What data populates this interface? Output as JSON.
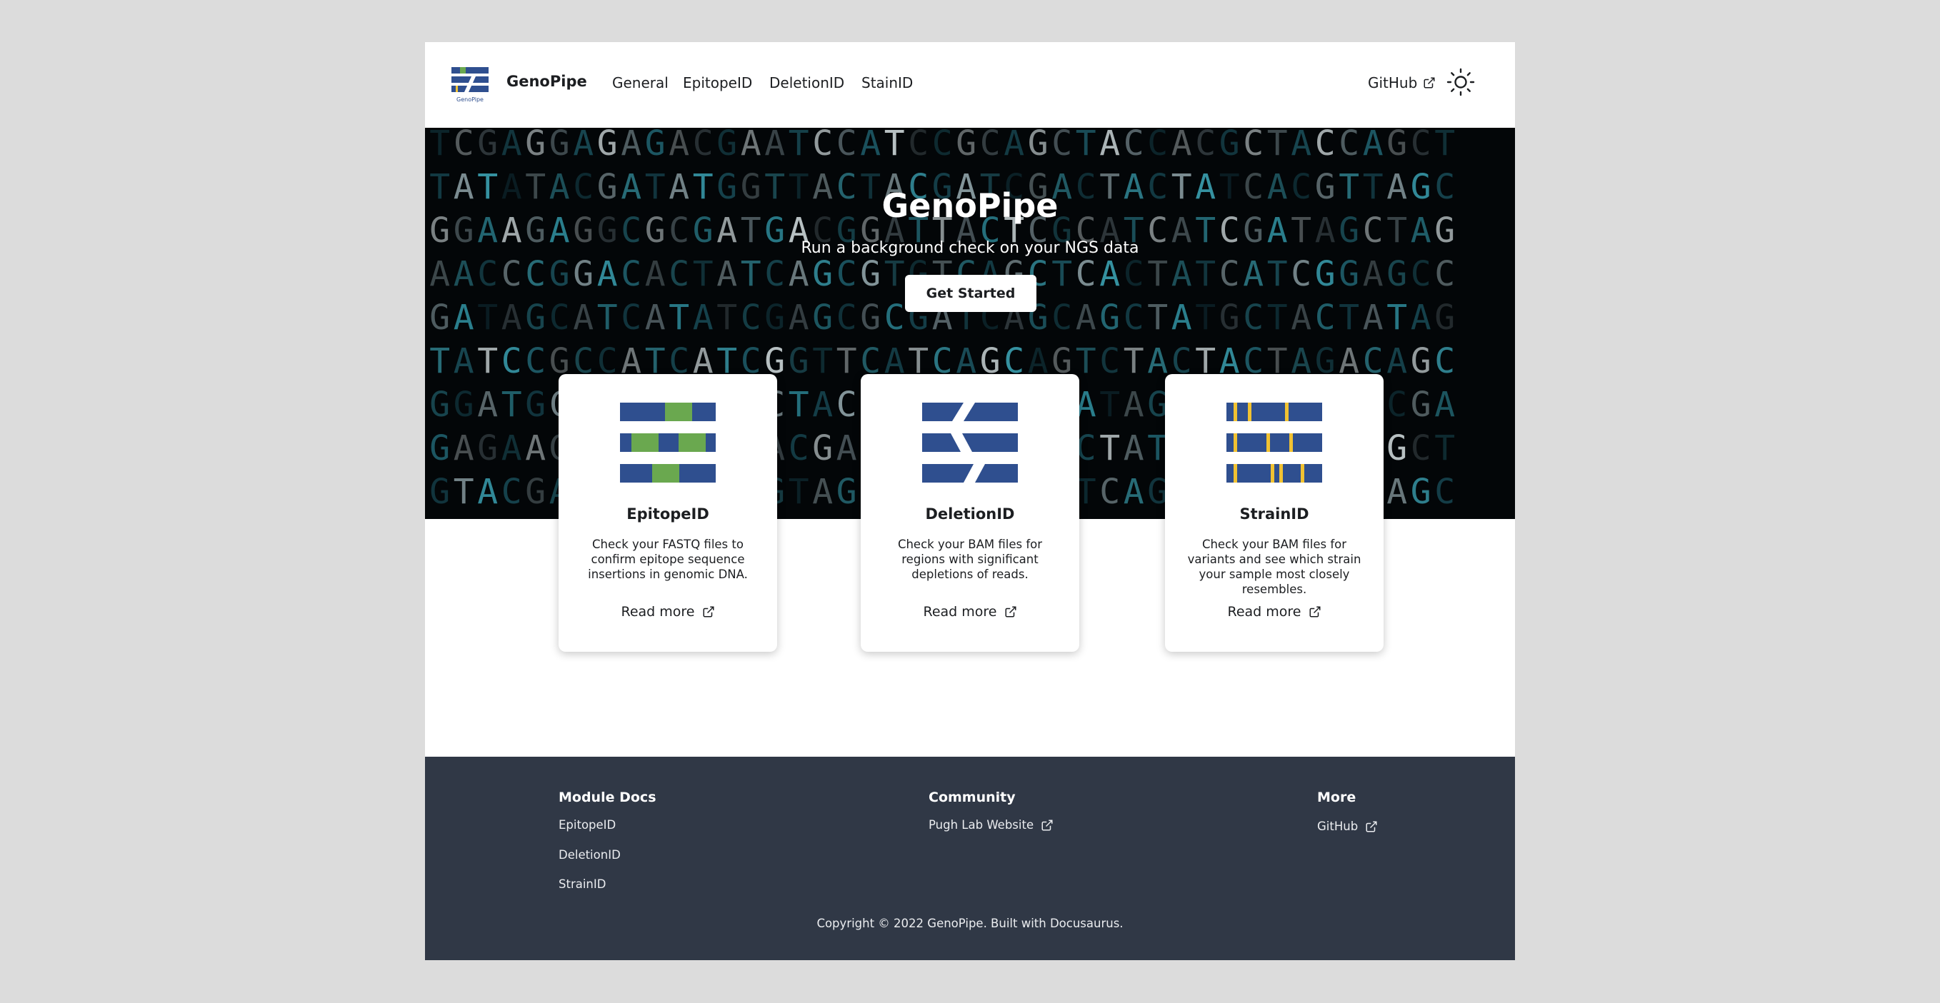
{
  "navbar": {
    "brand": "GenoPipe",
    "logo_caption": "GenoPipe",
    "links": [
      "General",
      "EpitopeID",
      "DeletionID",
      "StainID"
    ],
    "github": "GitHub",
    "theme_icon": "sun-icon"
  },
  "hero": {
    "title": "GenoPipe",
    "subtitle": "Run a background check on your NGS data",
    "cta": "Get Started",
    "background_rows": [
      "TCGAGGAGAGACGAATCCATCCGCAGCTACCACGCTACCAGCT",
      "TATATACGATATGGTTACTACGATCGACTACTATCACGTTAGC",
      "GGAAGAGGCGCGATGACGGATTACTCGCATCATCGATAGCTAG",
      "AACCCGGACACTATCAGCGTGTCAGCTCACTATCATCGGAGCC",
      "GATAGCATCATATCGAGCGCGATCAGCAGCTATGCTACTATAG",
      "TATCCGCCATCATCGGTTCATCAGCAGTCTACTACTAGACAGC",
      "GGATGCATAGACCGCTACGATCGCATCATAGCATGTAGAGCGA",
      "GAGAAGCATCATCGACGATCGATCACACTATCGATAGCTAGCT",
      "GTACGAGCATCGACGTAGCTACGAGCATCAGCAGTCTACGAGC"
    ]
  },
  "cards": [
    {
      "title": "EpitopeID",
      "description": "Check your FASTQ files to confirm epitope sequence insertions in genomic DNA.",
      "link": "Read more",
      "icon": "epitope-icon"
    },
    {
      "title": "DeletionID",
      "description": "Check your BAM files for regions with significant depletions of reads.",
      "link": "Read more",
      "icon": "deletion-icon"
    },
    {
      "title": "StrainID",
      "description": "Check your BAM files for variants and see which strain your sample most closely resembles.",
      "link": "Read more",
      "icon": "strain-icon"
    }
  ],
  "footer": {
    "columns": [
      {
        "title": "Module Docs",
        "links": [
          "EpitopeID",
          "DeletionID",
          "StrainID"
        ]
      },
      {
        "title": "Community",
        "links": [
          "Pugh Lab Website"
        ]
      },
      {
        "title": "More",
        "links": [
          "GitHub"
        ]
      }
    ],
    "copyright": "Copyright © 2022 GenoPipe. Built with Docusaurus."
  },
  "colors": {
    "bar_blue": "#2f4f8f",
    "epitope_green": "#6aa84f",
    "strain_yellow": "#f1c232",
    "footer_bg": "#303846",
    "hero_bg": "#030608",
    "dna_teal": "#2e8a9a"
  }
}
